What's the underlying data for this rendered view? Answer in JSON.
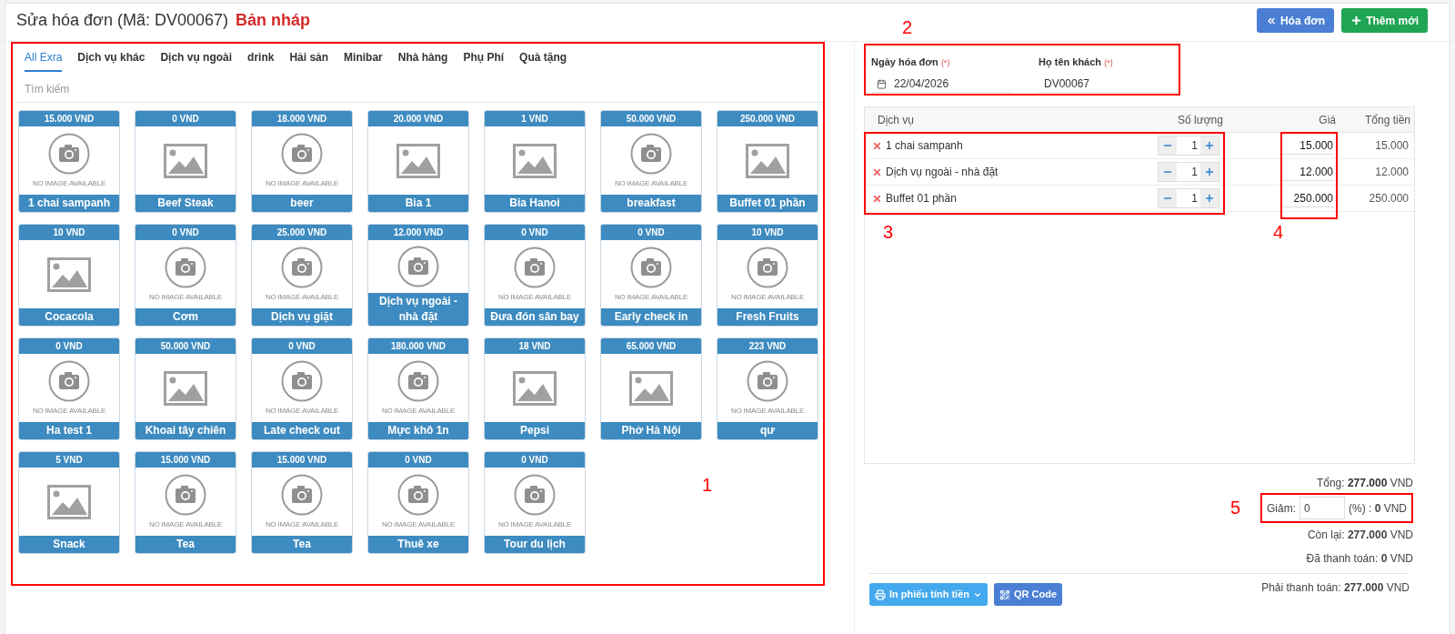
{
  "header": {
    "title": "Sửa hóa đơn (Mã: DV00067)",
    "status": "Bản nháp",
    "buttons": [
      {
        "label": "Hóa đơn",
        "kind": "back"
      },
      {
        "label": "Thêm mới",
        "kind": "add"
      }
    ]
  },
  "categories": [
    {
      "label": "All Exra",
      "selected": true
    },
    {
      "label": "Dịch vụ khác",
      "selected": false
    },
    {
      "label": "Dịch vụ ngoài",
      "selected": false
    },
    {
      "label": "drink",
      "selected": false
    },
    {
      "label": "Hải sản",
      "selected": false
    },
    {
      "label": "Minibar",
      "selected": false
    },
    {
      "label": "Nhà hàng",
      "selected": false
    },
    {
      "label": "Phụ Phí",
      "selected": false
    },
    {
      "label": "Quà tặng",
      "selected": false
    }
  ],
  "search": {
    "placeholder": "Tìm kiếm"
  },
  "products": [
    {
      "price": "15.000 VND",
      "name": "1 chai sampanh",
      "kind": "camera",
      "caption": "NO IMAGE AVAILABLE"
    },
    {
      "price": "0 VND",
      "name": "Beef Steak",
      "kind": "image"
    },
    {
      "price": "18.000 VND",
      "name": "beer",
      "kind": "camera",
      "caption": "NO IMAGE AVAILABLE"
    },
    {
      "price": "20.000 VND",
      "name": "Bia 1",
      "kind": "image"
    },
    {
      "price": "1 VND",
      "name": "Bia Hanoi",
      "kind": "image"
    },
    {
      "price": "50.000 VND",
      "name": "breakfast",
      "kind": "camera",
      "caption": "NO IMAGE AVAILABLE"
    },
    {
      "price": "250.000 VND",
      "name": "Buffet 01 phần",
      "kind": "image"
    },
    {
      "price": "10 VND",
      "name": "Cocacola",
      "kind": "image"
    },
    {
      "price": "0 VND",
      "name": "Cơm",
      "kind": "camera",
      "caption": "NO IMAGE AVAILABLE"
    },
    {
      "price": "25.000 VND",
      "name": "Dịch vụ giặt",
      "kind": "camera",
      "caption": "NO IMAGE AVAILABLE"
    },
    {
      "price": "12.000 VND",
      "name": "Dịch vụ ngoài - nhà đặt",
      "kind": "camera"
    },
    {
      "price": "0 VND",
      "name": "Đưa đón sân bay",
      "kind": "camera",
      "caption": "NO IMAGE AVAILABLE"
    },
    {
      "price": "0 VND",
      "name": "Early check in",
      "kind": "camera",
      "caption": "NO IMAGE AVAILABLE"
    },
    {
      "price": "10 VND",
      "name": "Fresh Fruits",
      "kind": "camera",
      "caption": "NO IMAGE AVAILABLE"
    },
    {
      "price": "0 VND",
      "name": "Ha test 1",
      "kind": "camera",
      "caption": "NO IMAGE AVAILABLE"
    },
    {
      "price": "50.000 VND",
      "name": "Khoai tây chiên",
      "kind": "image"
    },
    {
      "price": "0 VND",
      "name": "Late check out",
      "kind": "camera",
      "caption": "NO IMAGE AVAILABLE"
    },
    {
      "price": "180.000 VND",
      "name": "Mực khô 1n",
      "kind": "camera",
      "caption": "NO IMAGE AVAILABLE"
    },
    {
      "price": "18 VND",
      "name": "Pepsi",
      "kind": "image"
    },
    {
      "price": "65.000 VND",
      "name": "Phở Hà Nội",
      "kind": "image"
    },
    {
      "price": "223 VND",
      "name": "qư",
      "kind": "camera",
      "caption": "NO IMAGE AVAILABLE"
    },
    {
      "price": "5 VND",
      "name": "Snack",
      "kind": "image"
    },
    {
      "price": "15.000 VND",
      "name": "Tea",
      "kind": "camera",
      "caption": "NO IMAGE AVAILABLE"
    },
    {
      "price": "15.000 VND",
      "name": "Tea",
      "kind": "camera",
      "caption": "NO IMAGE AVAILABLE"
    },
    {
      "price": "0 VND",
      "name": "Thuê xe",
      "kind": "camera",
      "caption": "NO IMAGE AVAILABLE"
    },
    {
      "price": "0 VND",
      "name": "Tour du lịch",
      "kind": "camera",
      "caption": "NO IMAGE AVAILABLE"
    }
  ],
  "invoice_form": {
    "fields": [
      {
        "label": "Ngày hóa đơn",
        "required_mark": "(*)",
        "value": "22/04/2026",
        "kind": "date"
      },
      {
        "label": "Họ tên khách",
        "required_mark": "(*)",
        "value": "DV00067",
        "kind": "text"
      }
    ]
  },
  "services_table": {
    "columns": [
      "Dịch vụ",
      "Số lượng",
      "Giá",
      "Tổng tiền"
    ],
    "rows": [
      {
        "name": "1 chai sampanh",
        "quantity": "1",
        "price": "15.000",
        "total": "15.000"
      },
      {
        "name": "Dịch vụ ngoài - nhà đặt",
        "quantity": "1",
        "price": "12.000",
        "total": "12.000"
      },
      {
        "name": "Buffet 01 phần",
        "quantity": "1",
        "price": "250.000",
        "total": "250.000"
      }
    ]
  },
  "summary": {
    "total": "Tổng: **277.000** VND",
    "discount": {
      "label": "Giảm:",
      "value": "0",
      "suffix": "(%) : **0** VND"
    },
    "remaining": "Còn lại: **277.000** VND",
    "paid": "Đã thanh toán: **0** VND",
    "due": "Phải thanh toán: **277.000** VND"
  },
  "actions": [
    {
      "label": "In phiếu tính tiền",
      "kind": "print"
    },
    {
      "label": "QR Code",
      "kind": "qr"
    }
  ],
  "annotations": [
    {
      "label": "1"
    },
    {
      "label": "2"
    },
    {
      "label": "3"
    },
    {
      "label": "4"
    },
    {
      "label": "5"
    }
  ]
}
